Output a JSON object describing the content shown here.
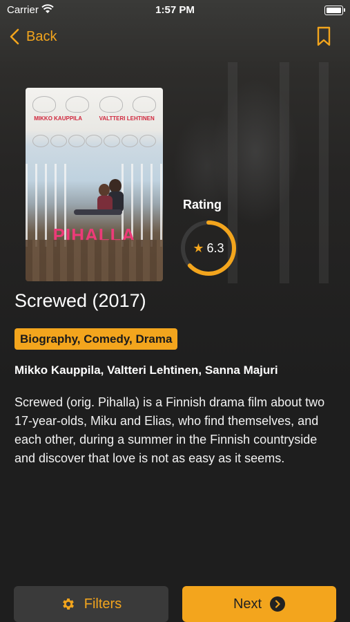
{
  "status_bar": {
    "carrier": "Carrier",
    "time": "1:57 PM"
  },
  "nav": {
    "back_label": "Back"
  },
  "poster": {
    "title_text": "PIHALLA",
    "actor_left": "MIKKO KAUPPILA",
    "actor_right": "VALTTERI LEHTINEN"
  },
  "rating": {
    "label": "Rating",
    "value": "6.3",
    "max": 10,
    "fraction": 0.63
  },
  "movie": {
    "title": "Screwed (2017)",
    "genres": "Biography, Comedy, Drama",
    "cast": "Mikko Kauppila, Valtteri Lehtinen, Sanna Majuri",
    "description": "Screwed (orig. Pihalla) is a Finnish drama film about two 17-year-olds, Miku and Elias, who find themselves, and each other, during a summer in the Finnish countryside and discover that love is not as easy as it seems."
  },
  "buttons": {
    "filters_label": "Filters",
    "next_label": "Next"
  },
  "colors": {
    "accent": "#f3a51d",
    "background": "#1e1e1e",
    "button_dark": "#3a3a3a"
  },
  "icons": {
    "back": "chevron-left-icon",
    "bookmark": "bookmark-icon",
    "star": "star-icon",
    "filters": "gear-icon",
    "next": "chevron-right-circle-icon"
  }
}
